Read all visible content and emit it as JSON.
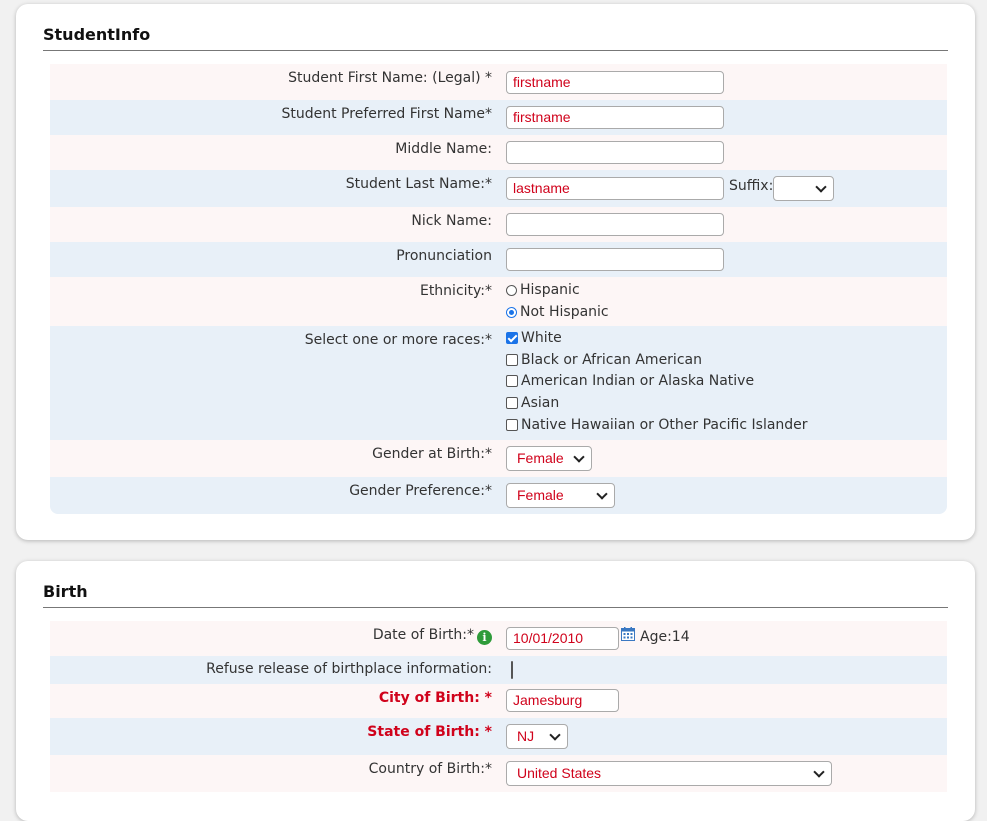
{
  "student_info": {
    "title": "StudentInfo",
    "first_name_legal": {
      "label": "Student First Name: (Legal) *",
      "value": "firstname"
    },
    "preferred_first_name": {
      "label": "Student Preferred First Name*",
      "value": "firstname"
    },
    "middle_name": {
      "label": "Middle Name:",
      "value": ""
    },
    "last_name": {
      "label": "Student Last Name:*",
      "value": "lastname"
    },
    "suffix": {
      "label": "Suffix:",
      "value": ""
    },
    "nick_name": {
      "label": "Nick Name:",
      "value": ""
    },
    "pronunciation": {
      "label": "Pronunciation",
      "value": ""
    },
    "ethnicity": {
      "label": "Ethnicity:*",
      "options": [
        "Hispanic",
        "Not Hispanic"
      ],
      "selected": "Not Hispanic"
    },
    "races": {
      "label": "Select one or more races:*",
      "options": [
        "White",
        "Black or African American",
        "American Indian or Alaska Native",
        "Asian",
        "Native Hawaiian or Other Pacific Islander"
      ],
      "checked": [
        "White"
      ]
    },
    "gender_at_birth": {
      "label": "Gender at Birth:*",
      "value": "Female"
    },
    "gender_preference": {
      "label": "Gender Preference:*",
      "value": "Female"
    }
  },
  "birth": {
    "title": "Birth",
    "date_of_birth": {
      "label": "Date of Birth:*",
      "value": "10/01/2010",
      "age_text": "Age:14",
      "info_icon": "info-icon",
      "calendar_icon": "calendar-icon"
    },
    "refuse_birthplace": {
      "label": "Refuse release of birthplace information:",
      "checked": false
    },
    "city_of_birth": {
      "label": "City of Birth: *",
      "value": "Jamesburg"
    },
    "state_of_birth": {
      "label": "State of Birth: *",
      "value": "NJ"
    },
    "country_of_birth": {
      "label": "Country of Birth:*",
      "value": "United States"
    }
  },
  "colors": {
    "required_red": "#d0021b",
    "row_pink": "#fdf6f6",
    "row_blue": "#e8f0f8",
    "accent_blue": "#1a73e8",
    "info_green": "#2e9b3a"
  }
}
